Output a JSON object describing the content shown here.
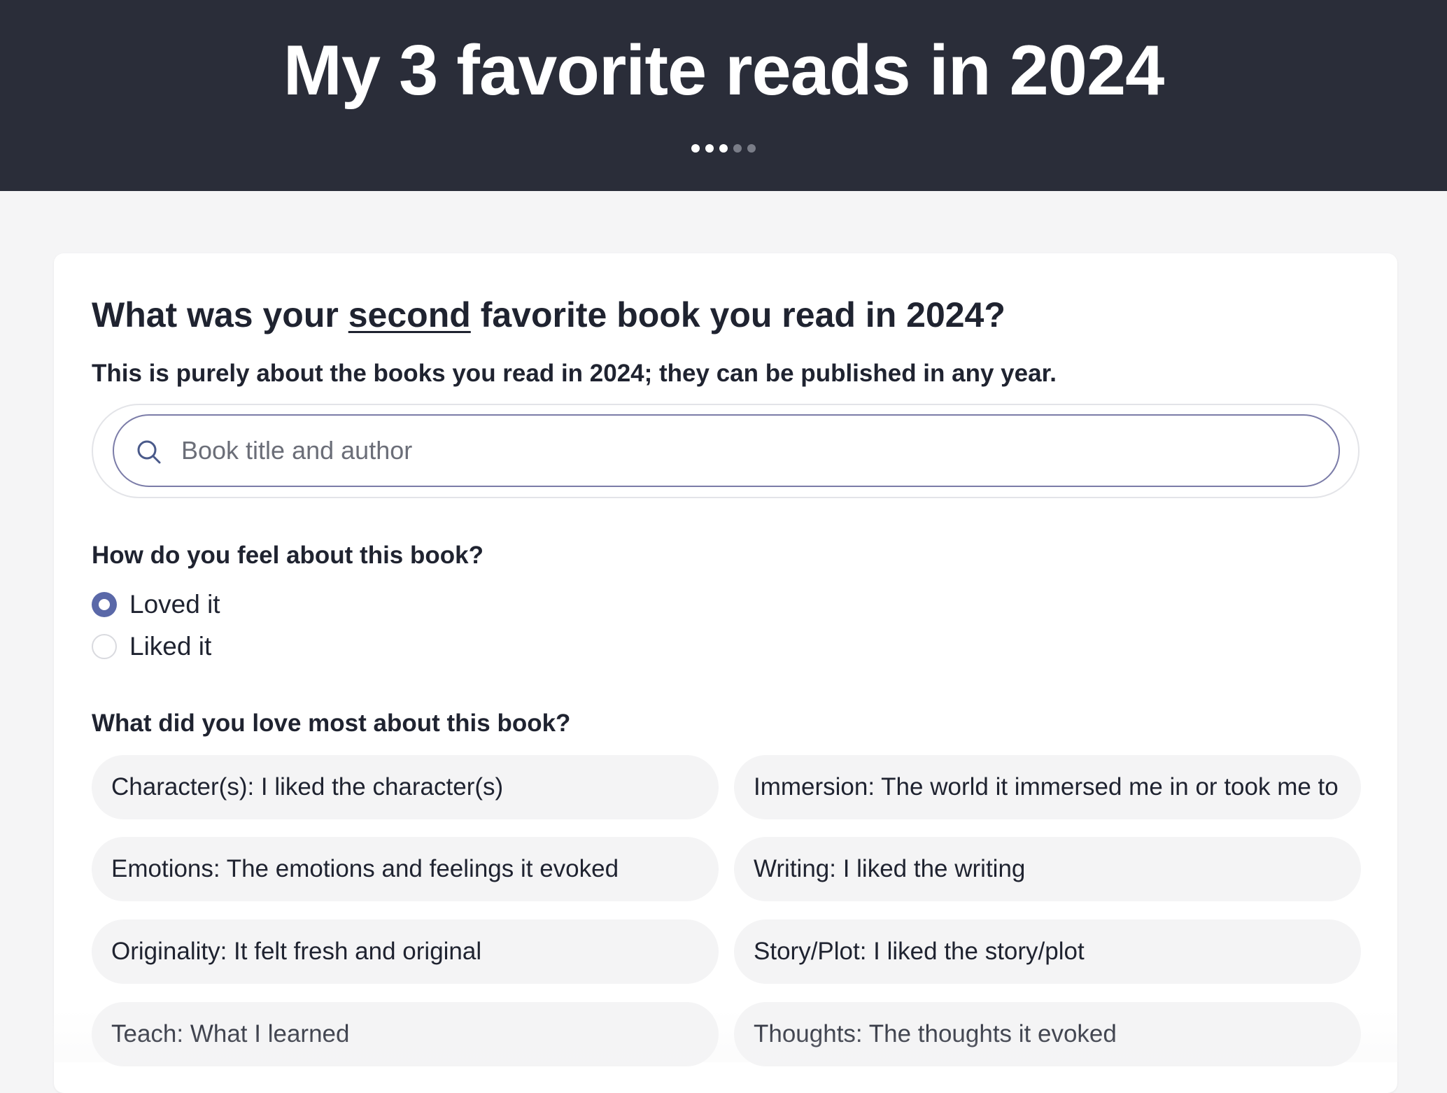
{
  "header": {
    "title": "My 3 favorite reads in 2024",
    "progress": {
      "total_steps": 5,
      "completed_steps": 3
    }
  },
  "question": {
    "title_before": "What was your ",
    "title_emphasis": "second",
    "title_after": " favorite book you read in 2024?",
    "subtitle": "This is purely about the books you read in 2024; they can be published in any year."
  },
  "search": {
    "placeholder": "Book title and author",
    "value": "",
    "icon": "search-icon"
  },
  "feeling": {
    "label": "How do you feel about this book?",
    "options": [
      {
        "label": "Loved it",
        "selected": true
      },
      {
        "label": "Liked it",
        "selected": false
      }
    ]
  },
  "love_most": {
    "label": "What did you love most about this book?",
    "options": [
      "Character(s): I liked the character(s)",
      "Immersion: The world it immersed me in or took me to",
      "Emotions: The emotions and feelings it evoked",
      "Writing: I liked the writing",
      "Originality: It felt fresh and original",
      "Story/Plot: I liked the story/plot",
      "Teach: What I learned",
      "Thoughts: The thoughts it evoked"
    ]
  },
  "colors": {
    "header_bg": "#2a2d39",
    "accent": "#5a68a8",
    "page_bg": "#f5f5f6",
    "chip_bg": "#f4f4f5"
  }
}
